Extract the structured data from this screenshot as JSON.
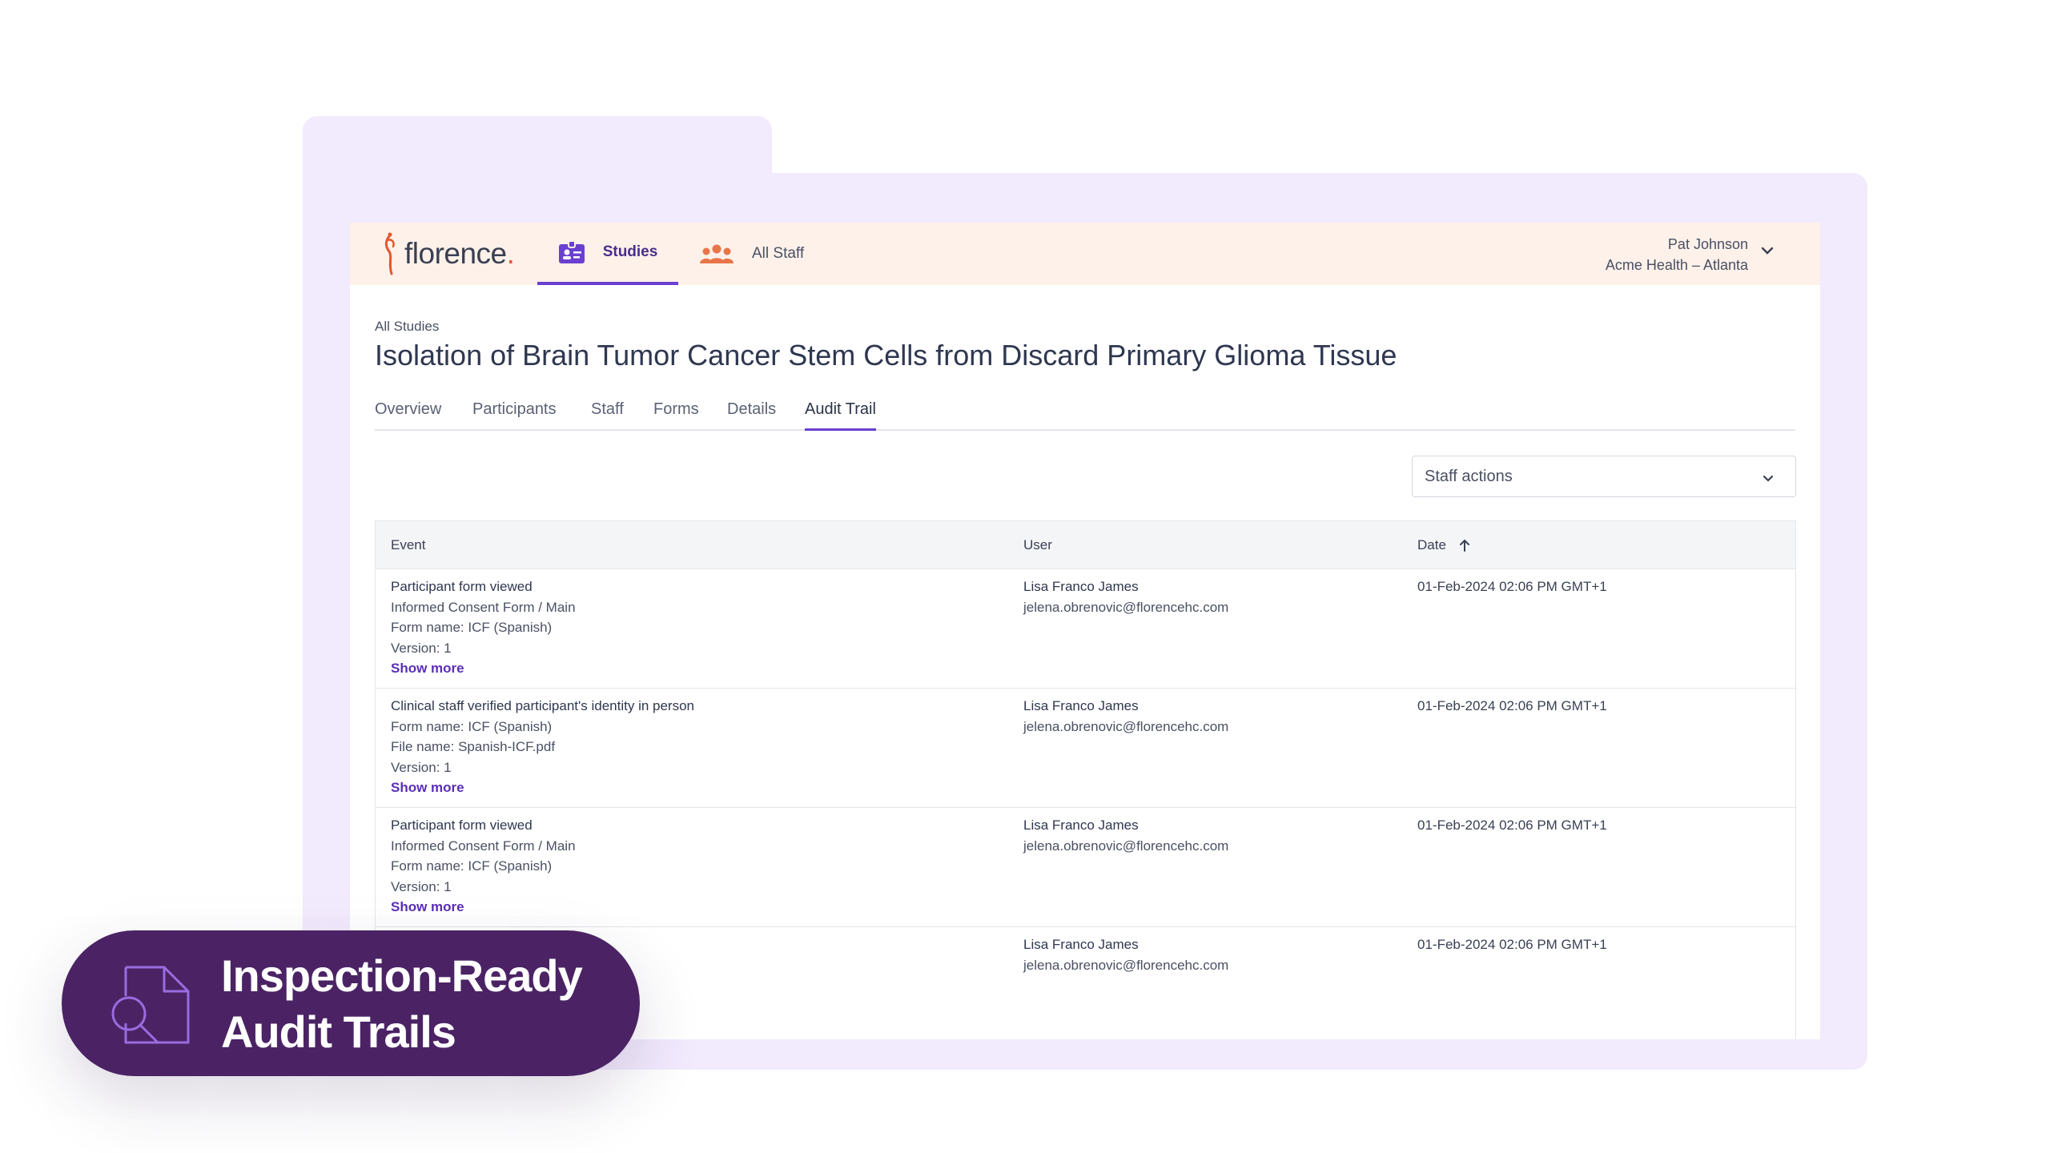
{
  "app": {
    "logo_text": "florence",
    "nav": {
      "studies_label": "Studies",
      "all_staff_label": "All Staff"
    },
    "user": {
      "name": "Pat Johnson",
      "org": "Acme Health – Atlanta"
    }
  },
  "page": {
    "breadcrumb": "All Studies",
    "title": "Isolation of Brain Tumor Cancer Stem Cells from Discard Primary Glioma Tissue",
    "tabs": [
      "Overview",
      "Participants",
      "Staff",
      "Forms",
      "Details",
      "Audit Trail"
    ],
    "active_tab": "Audit Trail"
  },
  "filter": {
    "selected": "Staff actions"
  },
  "table": {
    "headers": {
      "event": "Event",
      "user": "User",
      "date": "Date"
    },
    "show_more_label": "Show more",
    "rows": [
      {
        "event_title": "Participant form viewed",
        "event_lines": [
          "Informed Consent Form / Main",
          "Form name: ICF (Spanish)",
          "Version: 1"
        ],
        "user_name": "Lisa Franco James",
        "user_email": "jelena.obrenovic@florencehc.com",
        "date": "01-Feb-2024 02:06 PM GMT+1"
      },
      {
        "event_title": "Clinical staff verified participant's identity in person",
        "event_lines": [
          "Form name: ICF (Spanish)",
          "File name: Spanish-ICF.pdf",
          "Version: 1"
        ],
        "user_name": "Lisa Franco James",
        "user_email": "jelena.obrenovic@florencehc.com",
        "date": "01-Feb-2024 02:06 PM GMT+1"
      },
      {
        "event_title": "Participant form viewed",
        "event_lines": [
          "Informed Consent Form / Main",
          "Form name: ICF (Spanish)",
          "Version: 1"
        ],
        "user_name": "Lisa Franco James",
        "user_email": "jelena.obrenovic@florencehc.com",
        "date": "01-Feb-2024 02:06 PM GMT+1"
      },
      {
        "user_name": "Lisa Franco James",
        "user_email": "jelena.obrenovic@florencehc.com",
        "date": "01-Feb-2024 02:06 PM GMT+1"
      }
    ]
  },
  "badge": {
    "line1": "Inspection-Ready",
    "line2": "Audit Trails"
  },
  "colors": {
    "brand_purple": "#6b3fd0",
    "badge_bg": "#4b2365",
    "folder_bg": "#f2eafd",
    "topbar_bg": "#fdf1ea",
    "logo_accent": "#e4572e"
  }
}
